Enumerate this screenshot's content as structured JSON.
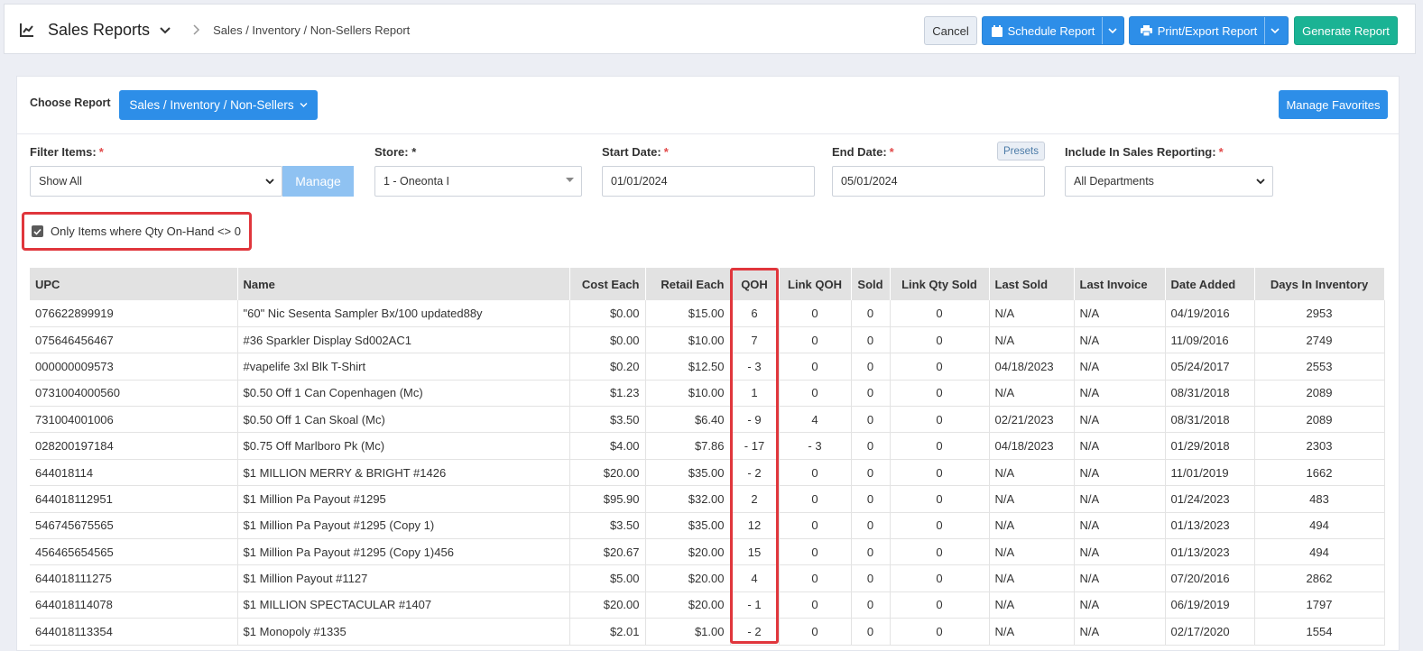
{
  "header": {
    "title": "Sales Reports",
    "breadcrumb": "Sales / Inventory / Non-Sellers Report",
    "cancel_label": "Cancel",
    "schedule_label": "Schedule Report",
    "print_label": "Print/Export Report",
    "generate_label": "Generate Report"
  },
  "report": {
    "choose_label": "Choose Report",
    "selected": "Sales / Inventory / Non-Sellers",
    "favorites_label": "Manage Favorites"
  },
  "filters": {
    "filter_items_label": "Filter Items:",
    "filter_items_value": "Show All",
    "manage_label": "Manage",
    "store_label": "Store:",
    "store_value": "1 - Oneonta I",
    "start_label": "Start Date:",
    "start_value": "01/01/2024",
    "end_label": "End Date:",
    "end_value": "05/01/2024",
    "presets_label": "Presets",
    "include_label": "Include In Sales Reporting:",
    "include_value": "All Departments",
    "required_mark": "*"
  },
  "checkbox": {
    "label": "Only Items where Qty On-Hand <> 0",
    "checked": true
  },
  "table": {
    "columns": [
      "UPC",
      "Name",
      "Cost Each",
      "Retail Each",
      "QOH",
      "Link QOH",
      "Sold",
      "Link Qty Sold",
      "Last Sold",
      "Last Invoice",
      "Date Added",
      "Days In Inventory"
    ],
    "rows": [
      [
        "076622899919",
        "\"60\" Nic Sesenta Sampler Bx/100 updated88y",
        "$0.00",
        "$15.00",
        "6",
        "0",
        "0",
        "0",
        "N/A",
        "N/A",
        "04/19/2016",
        "2953"
      ],
      [
        "075646456467",
        "#36 Sparkler Display Sd002AC1",
        "$0.00",
        "$10.00",
        "7",
        "0",
        "0",
        "0",
        "N/A",
        "N/A",
        "11/09/2016",
        "2749"
      ],
      [
        "000000009573",
        "#vapelife 3xl Blk T-Shirt",
        "$0.20",
        "$12.50",
        "- 3",
        "0",
        "0",
        "0",
        "04/18/2023",
        "N/A",
        "05/24/2017",
        "2553"
      ],
      [
        "0731004000560",
        "$0.50 Off 1 Can Copenhagen (Mc)",
        "$1.23",
        "$10.00",
        "1",
        "0",
        "0",
        "0",
        "N/A",
        "N/A",
        "08/31/2018",
        "2089"
      ],
      [
        "731004001006",
        "$0.50 Off 1 Can Skoal (Mc)",
        "$3.50",
        "$6.40",
        "- 9",
        "4",
        "0",
        "0",
        "02/21/2023",
        "N/A",
        "08/31/2018",
        "2089"
      ],
      [
        "028200197184",
        "$0.75 Off Marlboro Pk (Mc)",
        "$4.00",
        "$7.86",
        "- 17",
        "- 3",
        "0",
        "0",
        "04/18/2023",
        "N/A",
        "01/29/2018",
        "2303"
      ],
      [
        "644018114",
        "$1 MILLION MERRY & BRIGHT #1426",
        "$20.00",
        "$35.00",
        "- 2",
        "0",
        "0",
        "0",
        "N/A",
        "N/A",
        "11/01/2019",
        "1662"
      ],
      [
        "644018112951",
        "$1 Million Pa Payout #1295",
        "$95.90",
        "$32.00",
        "2",
        "0",
        "0",
        "0",
        "N/A",
        "N/A",
        "01/24/2023",
        "483"
      ],
      [
        "546745675565",
        "$1 Million Pa Payout #1295 (Copy 1)",
        "$3.50",
        "$35.00",
        "12",
        "0",
        "0",
        "0",
        "N/A",
        "N/A",
        "01/13/2023",
        "494"
      ],
      [
        "456465654565",
        "$1 Million Pa Payout #1295 (Copy 1)456",
        "$20.67",
        "$20.00",
        "15",
        "0",
        "0",
        "0",
        "N/A",
        "N/A",
        "01/13/2023",
        "494"
      ],
      [
        "644018111275",
        "$1 Million Payout #1127",
        "$5.00",
        "$20.00",
        "4",
        "0",
        "0",
        "0",
        "N/A",
        "N/A",
        "07/20/2016",
        "2862"
      ],
      [
        "644018114078",
        "$1 MILLION SPECTACULAR #1407",
        "$20.00",
        "$20.00",
        "- 1",
        "0",
        "0",
        "0",
        "N/A",
        "N/A",
        "06/19/2019",
        "1797"
      ],
      [
        "644018113354",
        "$1 Monopoly #1335",
        "$2.01",
        "$1.00",
        "- 2",
        "0",
        "0",
        "0",
        "N/A",
        "N/A",
        "02/17/2020",
        "1554"
      ]
    ]
  },
  "colors": {
    "primary": "#2d8ee8",
    "success": "#1ab394",
    "highlight": "#e0363c"
  }
}
